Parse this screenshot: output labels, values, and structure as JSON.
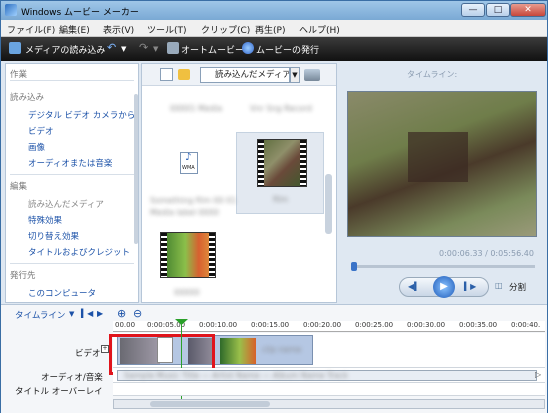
{
  "window": {
    "title": "Windows ムービー メーカー",
    "min": "—",
    "max": "□",
    "close": "✕"
  },
  "menu": [
    "ファイル(F)",
    "編集(E)",
    "表示(V)",
    "ツール(T)",
    "クリップ(C)",
    "再生(P)",
    "ヘルプ(H)"
  ],
  "toolbar": {
    "import": "メディアの読み込み",
    "automovie": "オートムービー",
    "publish": "ムービーの発行"
  },
  "tasks": {
    "header": "作業",
    "import_header": "読み込み",
    "import_items": [
      "デジタル ビデオ カメラから",
      "ビデオ",
      "画像",
      "オーディオまたは音楽"
    ],
    "edit_header": "編集",
    "edit_items": [
      "読み込んだメディア",
      "特殊効果",
      "切り替え効果",
      "タイトルおよびクレジット"
    ],
    "publish_header": "発行先",
    "publish_items": [
      "このコンピュータ"
    ]
  },
  "collection": {
    "dropdown": "読み込んだメディア",
    "wma_label": "WMA"
  },
  "preview": {
    "header": "タイムライン:",
    "time": "0:00:06.33 / 0:05:56.40",
    "split": "分割"
  },
  "timeline": {
    "label": "タイムライン",
    "ticks": [
      "00.00",
      "0:00:05.00",
      "0:00:10.00",
      "0:00:15.00",
      "0:00:20.00",
      "0:00:25.00",
      "0:00:30.00",
      "0:00:35.00",
      "0:00:40."
    ],
    "video": "ビデオ",
    "audio": "オーディオ/音楽",
    "title_overlay": "タイトル オーバーレイ"
  }
}
